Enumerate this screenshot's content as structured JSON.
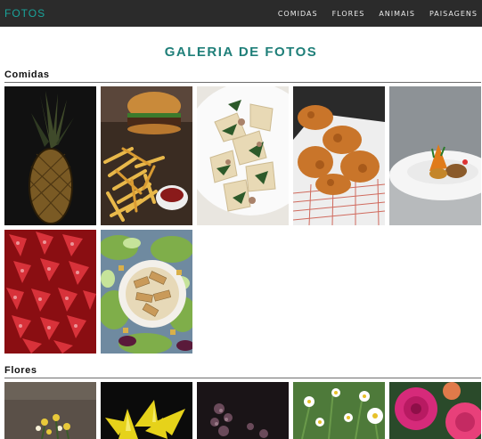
{
  "navbar": {
    "brand": "FOTOS",
    "links": [
      "COMIDAS",
      "FLORES",
      "ANIMAIS",
      "PAISAGENS"
    ]
  },
  "page": {
    "title": "GALERIA DE FOTOS"
  },
  "sections": [
    {
      "title": "Comidas",
      "photos": [
        "pineapple",
        "burger-and-fries",
        "pasta-plate",
        "fried-chicken",
        "gourmet-dish",
        "strawberries",
        "salad-bowl"
      ]
    },
    {
      "title": "Flores",
      "photos": [
        "yellow-small-flowers",
        "yellow-lily",
        "dark-purple-flowers",
        "white-daisies",
        "pink-roses"
      ]
    }
  ]
}
